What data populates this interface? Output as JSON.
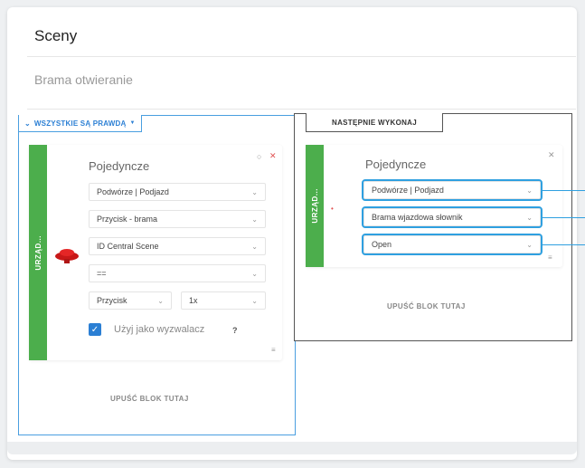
{
  "page": {
    "title": "Sceny",
    "scene_name": "Brama otwieranie"
  },
  "condition": {
    "header": "WSZYSTKIE SĄ PRAWDĄ",
    "device_label": "URZĄD...",
    "block_title": "Pojedyncze",
    "fields": {
      "location": "Podwórze | Podjazd",
      "device": "Przycisk - brama",
      "property": "ID Central Scene",
      "operator": "==",
      "key": "Przycisk",
      "count": "1x"
    },
    "checkbox_label": "Użyj jako wyzwalacz",
    "help": "?",
    "drop_label": "UPUŚĆ BLOK TUTAJ"
  },
  "action": {
    "tab_label": "NASTĘPNIE WYKONAJ",
    "device_label": "URZĄD...",
    "block_title": "Pojedyncze",
    "fields": {
      "location": "Podwórze | Podjazd",
      "device": "Brama wjazdowa słownik",
      "action": "Open"
    },
    "drop_label": "UPUŚĆ BLOK TUTAJ"
  },
  "icons": {
    "chevron": "chevron-down-icon",
    "close": "close-icon",
    "settings": "gear-icon",
    "menu": "menu-icon",
    "device": "button-device-icon"
  },
  "colors": {
    "accent": "#2b7fd4",
    "green": "#4cae4c",
    "highlight": "#2fa0e0",
    "danger": "#e05050"
  }
}
